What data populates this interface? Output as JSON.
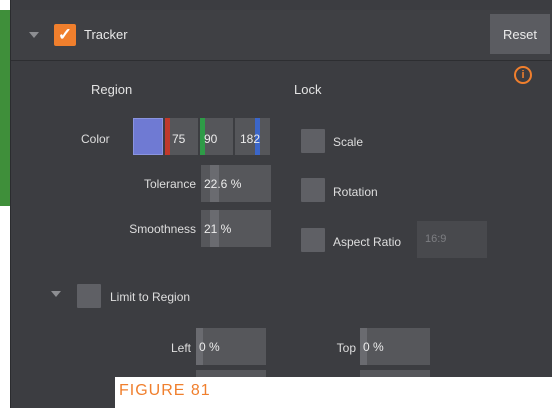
{
  "panel": {
    "title": "Tracker",
    "enabled": true,
    "reset_label": "Reset",
    "info_icon": "i"
  },
  "region": {
    "heading": "Region",
    "color_label": "Color",
    "color_swatch": "#6f7ad3",
    "channels": [
      {
        "value": "75",
        "color": "#c0392b"
      },
      {
        "value": "90",
        "color": "#2e9b47"
      },
      {
        "value": "182",
        "color": "#3b66c9"
      }
    ],
    "tolerance_label": "Tolerance",
    "tolerance_value": "22.6 %",
    "smoothness_label": "Smoothness",
    "smoothness_value": "21 %"
  },
  "lock": {
    "heading": "Lock",
    "scale_label": "Scale",
    "rotation_label": "Rotation",
    "aspect_label": "Aspect Ratio",
    "aspect_value": "16:9"
  },
  "limit": {
    "label": "Limit to Region",
    "left_label": "Left",
    "left_value": "0 %",
    "top_label": "Top",
    "top_value": "0 %"
  },
  "caption": "FIGURE 81",
  "colors": {
    "accent": "#f07f2d",
    "panel_bg": "#3c3d41",
    "field_bg": "#56575b"
  }
}
